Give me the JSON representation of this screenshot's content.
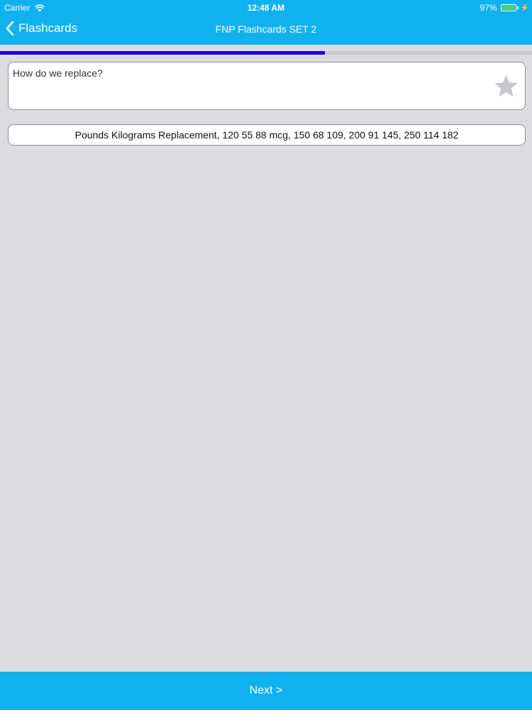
{
  "status_bar": {
    "carrier": "Carrier",
    "time": "12:48 AM",
    "battery_percent": "97%",
    "battery_level": 0.97
  },
  "nav": {
    "back_label": "Flashcards",
    "title": "FNP Flashcards SET 2"
  },
  "progress": {
    "fraction": 0.61,
    "color": "#1a00d6"
  },
  "card": {
    "question": "How do we replace?",
    "star_icon": "star-icon",
    "answer": "Pounds Kilograms Replacement, 120 55 88 mcg, 150 68 109, 200 91 145, 250 114 182"
  },
  "footer": {
    "next_label": "Next >"
  },
  "colors": {
    "accent": "#0fb2ef",
    "background": "#dcdbdf"
  }
}
